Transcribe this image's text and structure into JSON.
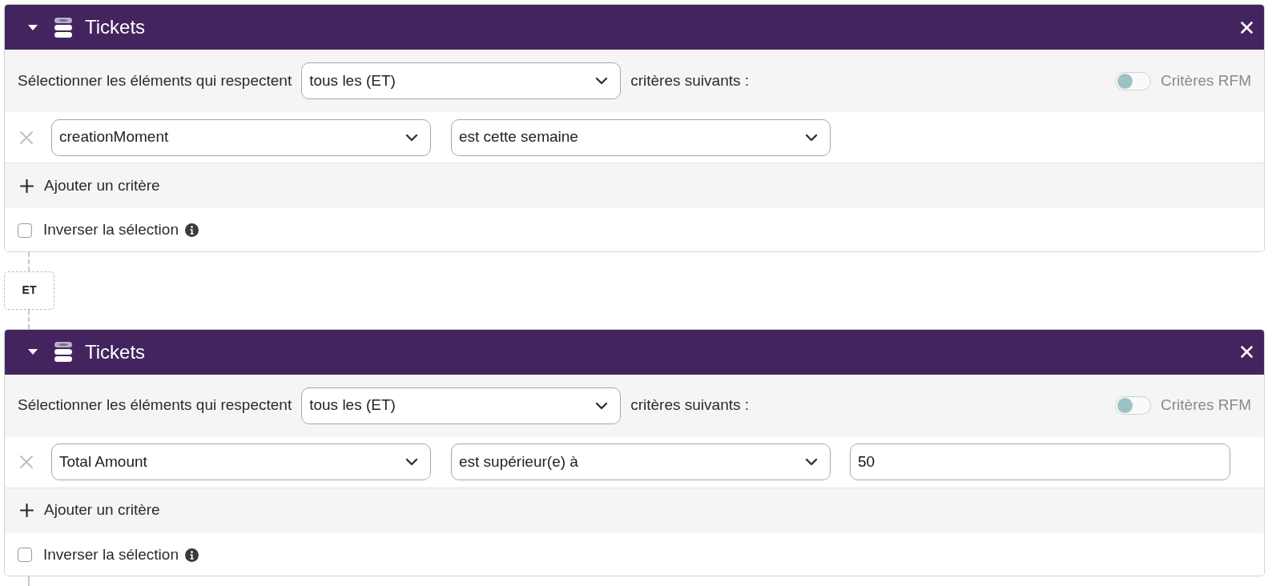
{
  "groups": [
    {
      "title": "Tickets",
      "expanded": true,
      "match_label": "Sélectionner les éléments qui respectent",
      "match_value": "tous les (ET)",
      "match_suffix": "critères suivants :",
      "rfm": {
        "label": "Critères RFM",
        "on": false
      },
      "criteria": [
        {
          "field": "creationMoment",
          "operator": "est cette semaine"
        }
      ],
      "add_label": "Ajouter un critère",
      "invert": {
        "label": "Inverser la sélection",
        "checked": false
      }
    },
    {
      "title": "Tickets",
      "expanded": true,
      "match_label": "Sélectionner les éléments qui respectent",
      "match_value": "tous les (ET)",
      "match_suffix": "critères suivants :",
      "rfm": {
        "label": "Critères RFM",
        "on": false
      },
      "criteria": [
        {
          "field": "Total Amount",
          "operator": "est supérieur(e) à",
          "value": "50"
        }
      ],
      "add_label": "Ajouter un critère",
      "invert": {
        "label": "Inverser la sélection",
        "checked": false
      }
    }
  ],
  "connectors": [
    {
      "label": "ET"
    }
  ]
}
